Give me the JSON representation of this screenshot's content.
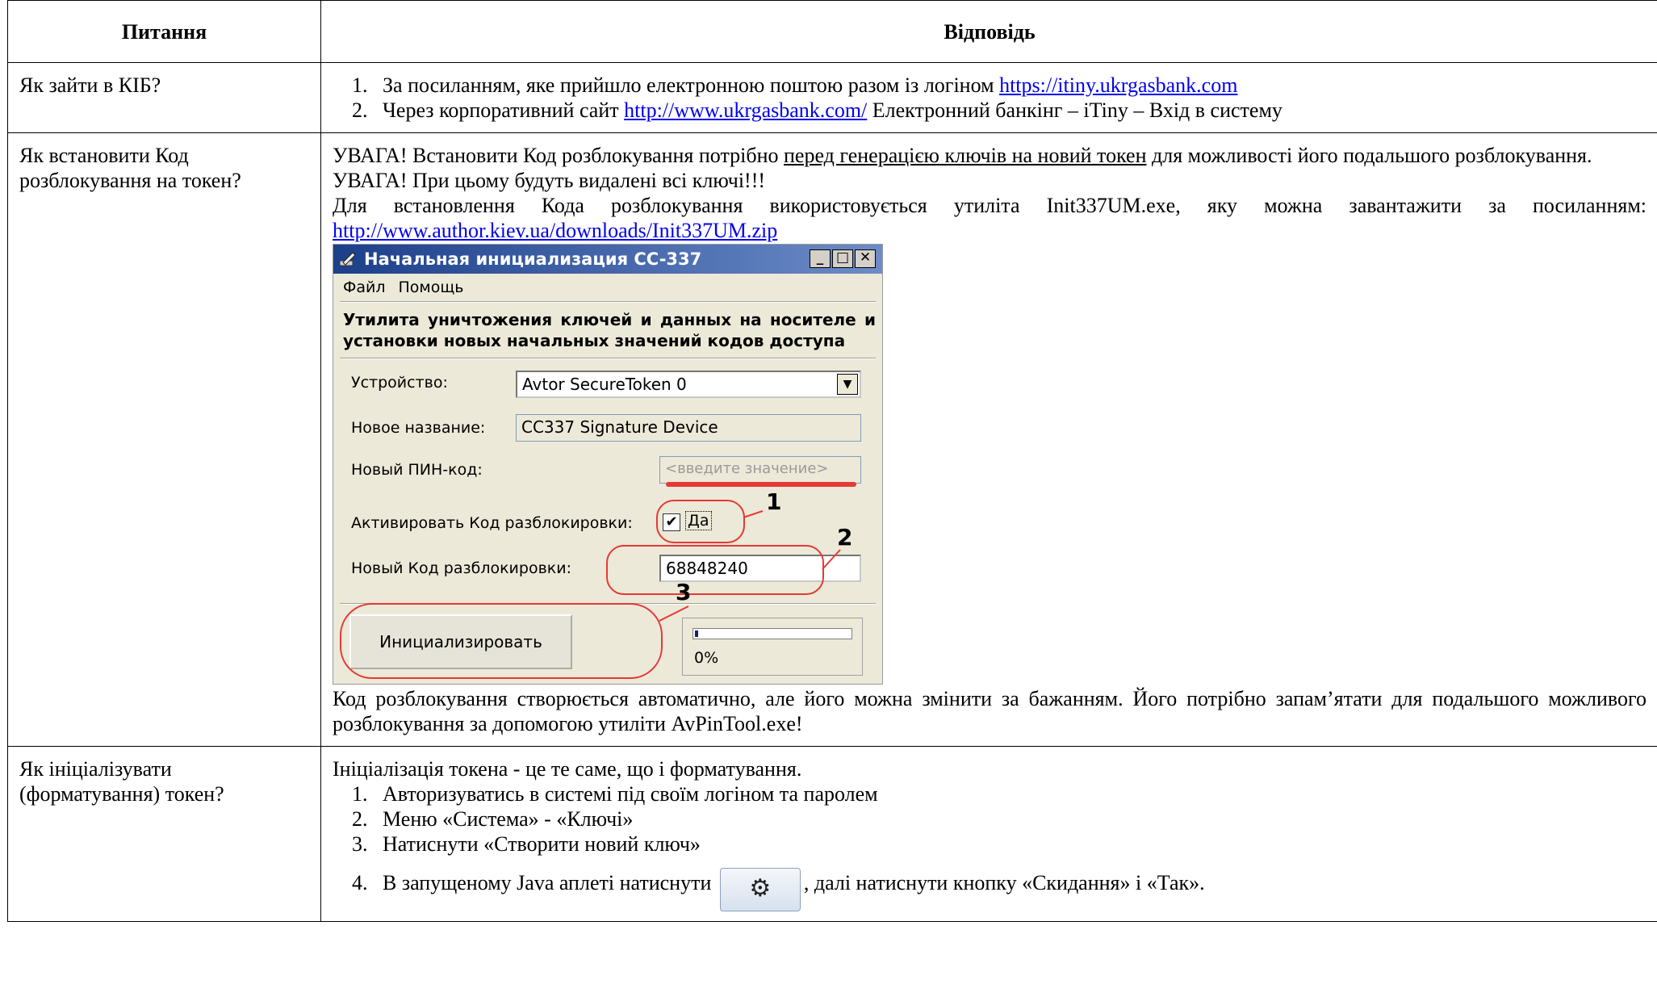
{
  "table": {
    "header_question": "Питання",
    "header_answer": "Відповідь"
  },
  "rows": {
    "login": {
      "question": "Як зайти в КІБ?",
      "item1_text": "За посиланням, яке прийшло електронною поштою разом із логіном ",
      "item1_link": "https://itiny.ukrgasbank.com",
      "item2_text": "Через корпоративний сайт ",
      "item2_link": "http://www.ukrgasbank.com/",
      "item2_tail": " Електронний банкінг – iTiny – Вхід в систему"
    },
    "unlock": {
      "question": "Як встановити Код розблокування на токен?",
      "p1_start": "УВАГА! Встановити Код розблокування потрібно ",
      "p1_underlined": "перед генерацією ключів на новий токен",
      "p1_end": " для можливості його подальшого розблокування.",
      "p2": "УВАГА! При цьому будуть видалені всі ключі!!!",
      "p3": "Для встановлення Кода розблокування використовується утиліта Init337UM.exe, яку можна завантажити за посиланням: ",
      "p3_link": "http://www.author.kiev.ua/downloads/Init337UM.zip",
      "p4": "Код розблокування створюється автоматично, але його можна змінити за бажанням. Його потрібно запам’ятати для подальшого можливого розблокування за допомогою утиліти AvPinTool.exe!"
    },
    "init": {
      "question": "Як ініціалізувати (форматування) токен?",
      "intro": "Ініціалізація токена - це те саме, що і форматування.",
      "step1": "Авторизуватись в системі під своїм логіном та паролем",
      "step2": "Меню «Система» - «Ключі»",
      "step3": "Натиснути «Створити новий ключ»",
      "step4_start": "В запущеному Java аплеті натиснути ",
      "step4_end": ", далі натиснути кнопку «Скидання» і «Так».",
      "gear_icon": "gear-icon"
    }
  },
  "dialog": {
    "title": "Начальная инициализация CC-337",
    "minimize": "_",
    "maximize": "□",
    "close": "✕",
    "menu_file": "Файл",
    "menu_help": "Помощь",
    "heading": "Утилита уничтожения ключей и данных на носителе и установки новых начальных значений кодов доступа",
    "device_label": "Устройство:",
    "device_value": "Avtor SecureToken 0",
    "name_label": "Новое название:",
    "name_value": "CC337 Signature Device",
    "pin_label": "Новый ПИН-код:",
    "pin_placeholder": "<введите значение>",
    "activate_label": "Активировать Код разблокировки:",
    "activate_checkbox_label": "Да",
    "activate_checked": true,
    "unlock_label": "Новый Код разблокировки:",
    "unlock_value": "68848240",
    "init_button": "Инициализировать",
    "progress_label": "0%",
    "progress_value": 0.02,
    "annotation_1": "1",
    "annotation_2": "2",
    "annotation_3": "3",
    "annotation_color": "#e53935"
  }
}
